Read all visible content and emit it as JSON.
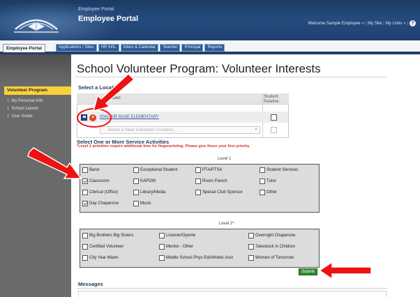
{
  "header": {
    "small_title": "Employee Portal",
    "title": "Employee Portal",
    "welcome": "Welcome Sample Employee",
    "my_site": "My Site",
    "my_links": "My Links",
    "sep": "|",
    "dropdown_glyph": "▿",
    "help_glyph": "?"
  },
  "tabs": {
    "active": "Employee Portal",
    "items": [
      "Applications / Sites",
      "HR Info.",
      "Inbox & Calendar",
      "Teacher",
      "Principal",
      "Reports"
    ]
  },
  "sidebar": {
    "active": "Volunteer Program",
    "bullet": "‡",
    "items": [
      "My Personal Info",
      "School Liaison",
      "User Guide"
    ]
  },
  "page": {
    "title": "School Volunteer Program: Volunteer Interests"
  },
  "location": {
    "section_title": "Select a Location",
    "header_name": "Location",
    "header_relative_1": "Student",
    "header_relative_2": "Relative",
    "row_name": "0041-AIR BASE ELEMENTARY",
    "select_placeholder": "Select a New Volunteer Location...",
    "delete_glyph": "×",
    "select_arrow": "▾"
  },
  "activities": {
    "section_title": "Select One or More Service Activities",
    "note": "*Level 2 activities require additional time for fingerprinting. Please give these your first priority.",
    "level1_label": "Level 1",
    "level2_label": "Level 2*",
    "level1": [
      [
        "Band",
        false
      ],
      [
        "Exceptional Student",
        false
      ],
      [
        "PTA/PTSA",
        false
      ],
      [
        "Student Services",
        false
      ],
      [
        "Classroom",
        true
      ],
      [
        "KAPOW",
        false
      ],
      [
        "Room Parent",
        false
      ],
      [
        "Tutor",
        false
      ],
      [
        "Clerical (Office)",
        false
      ],
      [
        "Library/Media",
        false
      ],
      [
        "Special Club Sponsor",
        false
      ],
      [
        "Other",
        false
      ],
      [
        "Day Chaperone",
        true
      ],
      [
        "Music",
        false
      ]
    ],
    "level2": [
      [
        "Big Brothers Big Sisters",
        false
      ],
      [
        "Listener/Oyente",
        false
      ],
      [
        "Overnight Chaperone",
        false
      ],
      [
        "Certified Volunteer",
        false
      ],
      [
        "Mentor - Other",
        false
      ],
      [
        "Takestock in Children",
        false
      ],
      [
        "City Year Miami",
        false
      ],
      [
        "Middle School Phys Ed/Athletic Asst",
        false
      ],
      [
        "Women of Tomorrow",
        false
      ]
    ]
  },
  "buttons": {
    "submit": "Submit"
  },
  "messages": {
    "title": "Messages"
  },
  "colors": {
    "header_bg": "#1f4170",
    "active_sidebar": "#f8d23a",
    "submit_green": "#2e8b2e",
    "annotation_red": "#e11"
  }
}
